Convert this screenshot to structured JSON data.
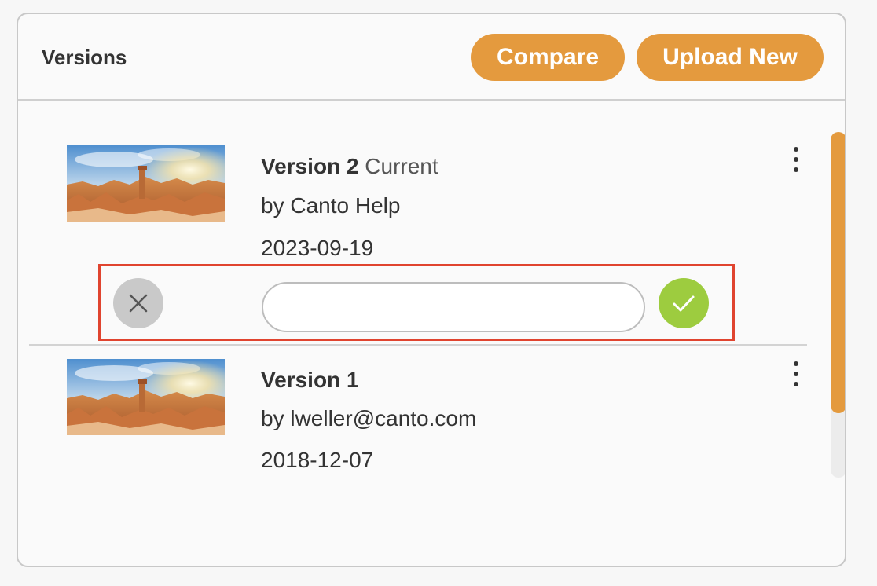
{
  "panel": {
    "title": "Versions",
    "compare_label": "Compare",
    "upload_label": "Upload New"
  },
  "versions": [
    {
      "name": "Version 2",
      "status": "Current",
      "author": "by Canto Help",
      "date": "2023-09-19",
      "thumbnail_icon": "canyon-landscape-thumbnail"
    },
    {
      "name": "Version 1",
      "status": "",
      "author": "by lweller@canto.com",
      "date": "2018-12-07",
      "thumbnail_icon": "canyon-landscape-thumbnail"
    }
  ],
  "comment_editor": {
    "value": "",
    "placeholder": "",
    "cancel_icon": "close-icon",
    "confirm_icon": "checkmark-icon"
  },
  "colors": {
    "accent": "#e49a3e",
    "confirm": "#9dcc3f",
    "highlight_border": "#e0442f"
  }
}
